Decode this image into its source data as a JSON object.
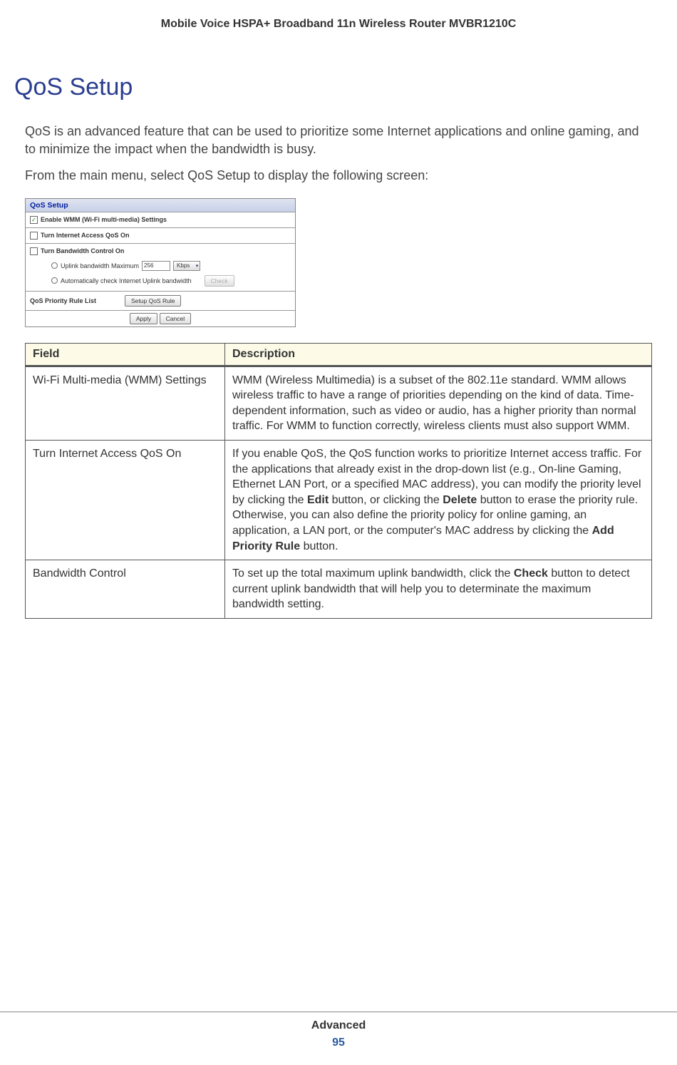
{
  "header": {
    "title": "Mobile Voice HSPA+ Broadband 11n Wireless Router MVBR1210C"
  },
  "page": {
    "heading": "QoS Setup",
    "intro1": "QoS is an advanced feature that can be used to prioritize some Internet applications and online gaming, and to minimize the impact when the bandwidth is busy.",
    "intro2": "From the main menu, select QoS Setup to display the following screen:"
  },
  "screenshot": {
    "title": "QoS Setup",
    "wmm_checked": true,
    "wmm_label": "Enable WMM (Wi-Fi multi-media) Settings",
    "qos_checked": false,
    "qos_label": "Turn Internet Access QoS On",
    "bwc_checked": false,
    "bwc_label": "Turn Bandwidth Control On",
    "uplink_label": "Uplink bandwidth Maximum",
    "uplink_value": "256",
    "uplink_unit": "Kbps",
    "auto_label": "Automatically check Internet Uplink bandwidth",
    "check_btn": "Check",
    "rule_list_label": "QoS Priority Rule List",
    "setup_rule_btn": "Setup QoS Rule",
    "apply_btn": "Apply",
    "cancel_btn": "Cancel"
  },
  "table": {
    "header_field": "Field",
    "header_desc": "Description",
    "rows": [
      {
        "field": "Wi-Fi Multi-media (WMM) Settings",
        "desc": "WMM (Wireless Multimedia) is a subset of the 802.11e standard. WMM allows wireless traffic to have a range of priorities depending on the kind of data. Time-dependent information, such as video or audio, has a higher priority than normal traffic. For WMM to function correctly, wireless clients must also support WMM."
      },
      {
        "field": "Turn Internet Access QoS On",
        "desc_html": "If you enable QoS, the QoS function works to prioritize Internet access traffic. For the applications that already exist in the drop-down list (e.g., On-line Gaming, Ethernet LAN Port, or a specified MAC address), you can modify the priority level by clicking the <b>Edit</b> button, or clicking the <b>Delete</b> button to erase the priority rule. Otherwise, you can also define the priority policy for online gaming, an application, a LAN port, or the computer's MAC address by clicking the <b>Add Priority Rule</b> button."
      },
      {
        "field": "Bandwidth Control",
        "desc_html": "To set up the total maximum uplink bandwidth, click the <b>Check</b> button to detect current uplink bandwidth that will help you to determinate the maximum bandwidth setting."
      }
    ]
  },
  "footer": {
    "section": "Advanced",
    "page_number": "95"
  }
}
